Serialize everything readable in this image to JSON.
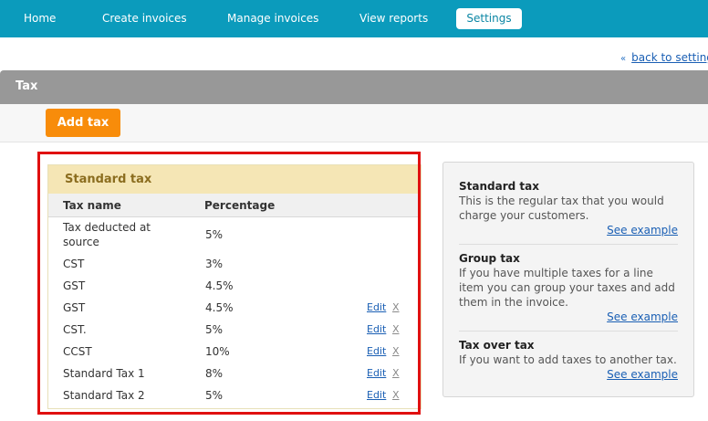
{
  "nav": {
    "items": [
      "Home",
      "Create invoices",
      "Manage invoices",
      "View reports"
    ],
    "active": "Settings"
  },
  "back_link": {
    "icon": "double-chevron-left-icon",
    "label": "back to settings"
  },
  "section": {
    "title": "Tax"
  },
  "toolbar": {
    "add_label": "Add tax",
    "accent": "#f88c0a"
  },
  "standard_tax": {
    "title": "Standard tax",
    "columns": [
      "Tax name",
      "Percentage"
    ],
    "rows": [
      {
        "name": "Tax deducted at\nsource",
        "percentage": "5%"
      },
      {
        "name": "CST",
        "percentage": "3%"
      },
      {
        "name": "GST",
        "percentage": "4.5%"
      },
      {
        "name": "GST",
        "percentage": "4.5%",
        "edit": "Edit",
        "delete": "X"
      },
      {
        "name": "CST.",
        "percentage": "5%",
        "edit": "Edit",
        "delete": "X"
      },
      {
        "name": "CCST",
        "percentage": "10%",
        "edit": "Edit",
        "delete": "X"
      },
      {
        "name": "Standard Tax 1",
        "percentage": "8%",
        "edit": "Edit",
        "delete": "X"
      },
      {
        "name": "Standard Tax 2",
        "percentage": "5%",
        "edit": "Edit",
        "delete": "X"
      }
    ]
  },
  "info": [
    {
      "title": "Standard tax",
      "desc": "This is the regular tax that you would charge your customers.",
      "link": "See example"
    },
    {
      "title": "Group tax",
      "desc": "If you have multiple taxes for a line item you can group your taxes and add them in the invoice.",
      "link": "See example"
    },
    {
      "title": "Tax over tax",
      "desc": "If you want to add taxes to another tax.",
      "link": "See example"
    }
  ],
  "colors": {
    "nav_bg": "#0b9bbc",
    "highlight": "#e01010",
    "section_header": "#989898"
  }
}
